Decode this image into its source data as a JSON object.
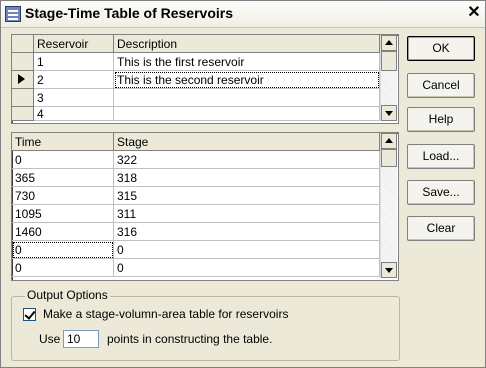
{
  "window": {
    "title": "Stage-Time Table of Reservoirs"
  },
  "reservoir_grid": {
    "headers": [
      "Reservoir",
      "Description"
    ],
    "rows": [
      [
        "1",
        "This is the first reservoir"
      ],
      [
        "2",
        "This is the second reservoir"
      ],
      [
        "3",
        ""
      ],
      [
        "4",
        ""
      ]
    ]
  },
  "stage_grid": {
    "headers": [
      "Time",
      "Stage"
    ],
    "rows": [
      [
        "0",
        "322"
      ],
      [
        "365",
        "318"
      ],
      [
        "730",
        "315"
      ],
      [
        "1095",
        "311"
      ],
      [
        "1460",
        "316"
      ],
      [
        "0",
        "0"
      ],
      [
        "0",
        "0"
      ]
    ]
  },
  "buttons": {
    "ok": "OK",
    "cancel": "Cancel",
    "help": "Help",
    "load": "Load...",
    "save": "Save...",
    "clear": "Clear"
  },
  "output_options": {
    "legend": "Output Options",
    "checkbox_label": "Make a stage-volumn-area table for reservoirs",
    "checked": true,
    "use_label": "Use",
    "points_value": "10",
    "points_suffix": "points in constructing the table."
  },
  "icons": {
    "app": "reservoir-app-icon",
    "close": "close-icon",
    "row-pointer": "row-pointer-icon"
  }
}
